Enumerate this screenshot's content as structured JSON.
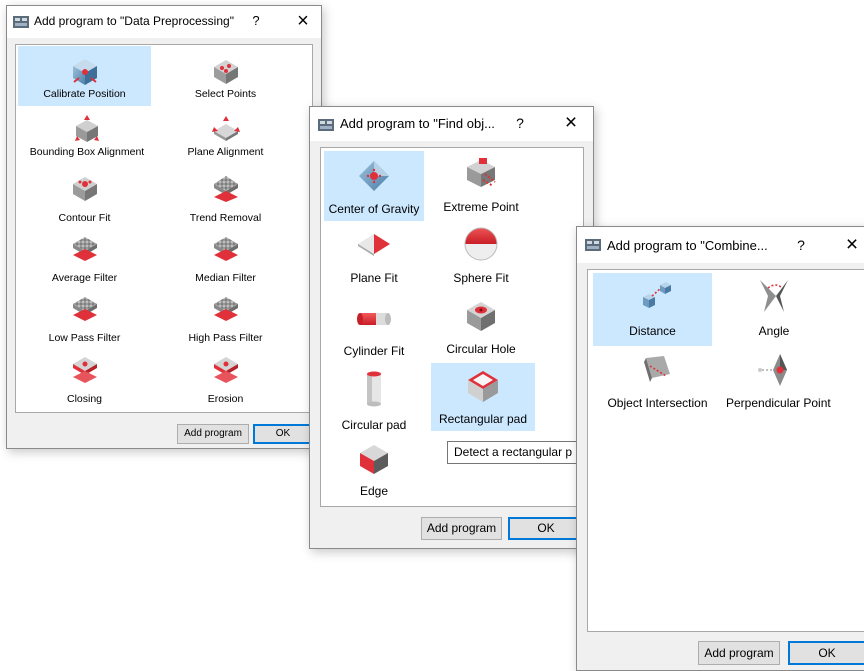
{
  "dialog1": {
    "title": "Add program to \"Data Preprocessing\"",
    "help": "?",
    "close": "×",
    "items": [
      {
        "label": "Calibrate Position",
        "icon": "calibrate-position-icon"
      },
      {
        "label": "Select Points",
        "icon": "select-points-icon"
      },
      {
        "label": "Bounding Box Alignment",
        "icon": "bounding-box-alignment-icon"
      },
      {
        "label": "Plane Alignment",
        "icon": "plane-alignment-icon"
      },
      {
        "label": "Contour Fit",
        "icon": "contour-fit-icon"
      },
      {
        "label": "Trend Removal",
        "icon": "trend-removal-icon"
      },
      {
        "label": "Average Filter",
        "icon": "average-filter-icon"
      },
      {
        "label": "Median Filter",
        "icon": "median-filter-icon"
      },
      {
        "label": "Low Pass Filter",
        "icon": "low-pass-filter-icon"
      },
      {
        "label": "High Pass Filter",
        "icon": "high-pass-filter-icon"
      },
      {
        "label": "Closing",
        "icon": "closing-icon"
      },
      {
        "label": "Erosion",
        "icon": "erosion-icon"
      }
    ],
    "add_program": "Add program",
    "ok": "OK"
  },
  "dialog2": {
    "title": "Add program to \"Find obj...",
    "help": "?",
    "close": "×",
    "items": [
      {
        "label": "Center of Gravity",
        "icon": "center-of-gravity-icon"
      },
      {
        "label": "Extreme Point",
        "icon": "extreme-point-icon"
      },
      {
        "label": "Plane Fit",
        "icon": "plane-fit-icon"
      },
      {
        "label": "Sphere Fit",
        "icon": "sphere-fit-icon"
      },
      {
        "label": "Cylinder Fit",
        "icon": "cylinder-fit-icon"
      },
      {
        "label": "Circular Hole",
        "icon": "circular-hole-icon"
      },
      {
        "label": "Circular pad",
        "icon": "circular-pad-icon"
      },
      {
        "label": "Rectangular pad",
        "icon": "rectangular-pad-icon"
      },
      {
        "label": "Edge",
        "icon": "edge-icon"
      }
    ],
    "tooltip": "Detect a rectangular p",
    "add_program": "Add program",
    "ok": "OK"
  },
  "dialog3": {
    "title": "Add program to \"Combine...",
    "help": "?",
    "close": "×",
    "items": [
      {
        "label": "Distance",
        "icon": "distance-icon"
      },
      {
        "label": "Angle",
        "icon": "angle-icon"
      },
      {
        "label": "Object Intersection",
        "icon": "object-intersection-icon"
      },
      {
        "label": "Perpendicular Point",
        "icon": "perpendicular-point-icon"
      }
    ],
    "add_program": "Add program",
    "ok": "OK"
  },
  "colors": {
    "selection": "#cce8ff",
    "accent_red": "#e0303a",
    "default_button_border": "#0078d7"
  }
}
